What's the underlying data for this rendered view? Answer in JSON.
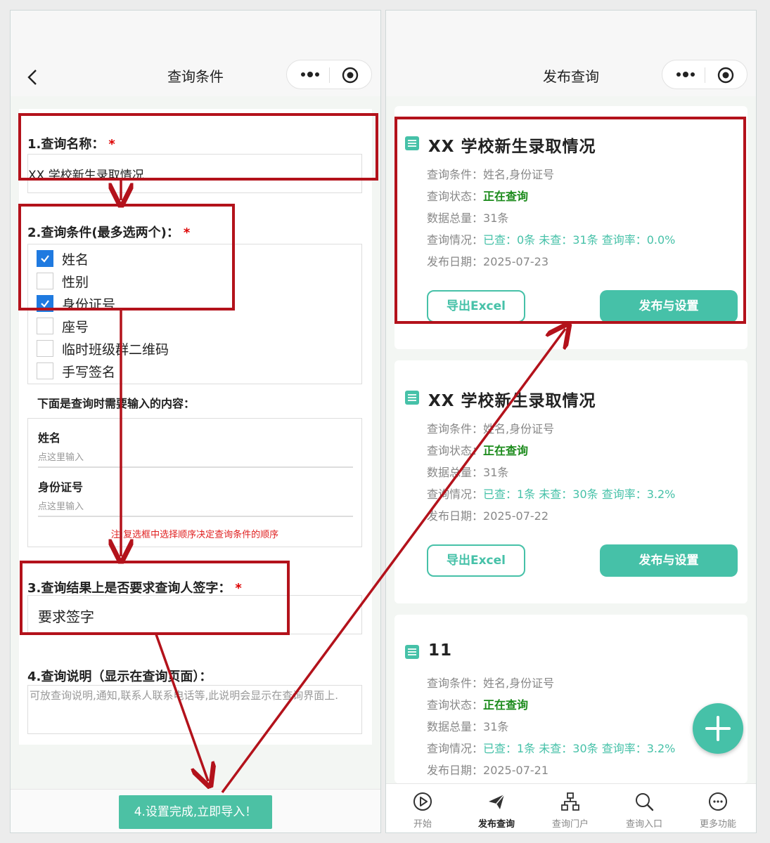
{
  "left_screen": {
    "nav_title": "查询条件",
    "field1": {
      "label": "1.查询名称：",
      "required_mark": "*",
      "value": "XX 学校新生录取情况"
    },
    "field2": {
      "label": "2.查询条件(最多选两个)：",
      "required_mark": "*",
      "options": [
        {
          "label": "姓名",
          "checked": true
        },
        {
          "label": "性别",
          "checked": false
        },
        {
          "label": "身份证号",
          "checked": true
        },
        {
          "label": "座号",
          "checked": false
        },
        {
          "label": "临时班级群二维码",
          "checked": false
        },
        {
          "label": "手写签名",
          "checked": false
        }
      ]
    },
    "input_hint_title": "下面是查询时需要输入的内容：",
    "input_preview": {
      "fields": [
        {
          "label": "姓名",
          "placeholder": "点这里输入"
        },
        {
          "label": "身份证号",
          "placeholder": "点这里输入"
        }
      ],
      "note": "注:复选框中选择顺序决定查询条件的顺序"
    },
    "field3": {
      "label": "3.查询结果上是否要求查询人签字：",
      "required_mark": "*",
      "value": "要求签字"
    },
    "field4": {
      "label": "4.查询说明（显示在查询页面）：",
      "placeholder": "可放查询说明,通知,联系人联系电话等,此说明会显示在查询界面上."
    },
    "import_button": "4.设置完成,立即导入！"
  },
  "right_screen": {
    "nav_title": "发布查询",
    "row_labels": {
      "condition": "查询条件：",
      "status": "查询状态：",
      "total": "数据总量：",
      "progress": "查询情况：",
      "date": "发布日期："
    },
    "cards": [
      {
        "title": "XX 学校新生录取情况",
        "condition": "姓名,身份证号",
        "status": "正在查询",
        "total": "31条",
        "progress": "已查：0条 未查：31条 查询率：0.0%",
        "date": "2025-07-23"
      },
      {
        "title": "XX 学校新生录取情况",
        "condition": "姓名,身份证号",
        "status": "正在查询",
        "total": "31条",
        "progress": "已查：1条 未查：30条 查询率：3.2%",
        "date": "2025-07-22"
      },
      {
        "title": "11",
        "condition": "姓名,身份证号",
        "status": "正在查询",
        "total": "31条",
        "progress": "已查：1条 未查：30条 查询率：3.2%",
        "date": "2025-07-21"
      }
    ],
    "export_button": "导出Excel",
    "publish_button": "发布与设置",
    "tabs": [
      {
        "label": "开始",
        "icon": "play-circle-icon",
        "active": false
      },
      {
        "label": "发布查询",
        "icon": "paper-plane-icon",
        "active": true
      },
      {
        "label": "查询门户",
        "icon": "sitemap-icon",
        "active": false
      },
      {
        "label": "查询入口",
        "icon": "search-icon",
        "active": false
      },
      {
        "label": "更多功能",
        "icon": "more-circle-icon",
        "active": false
      }
    ]
  },
  "colors": {
    "accent": "#46c1a8",
    "annotation": "#b3121b",
    "status_green": "#1a8a1a",
    "required": "#dd0000"
  }
}
